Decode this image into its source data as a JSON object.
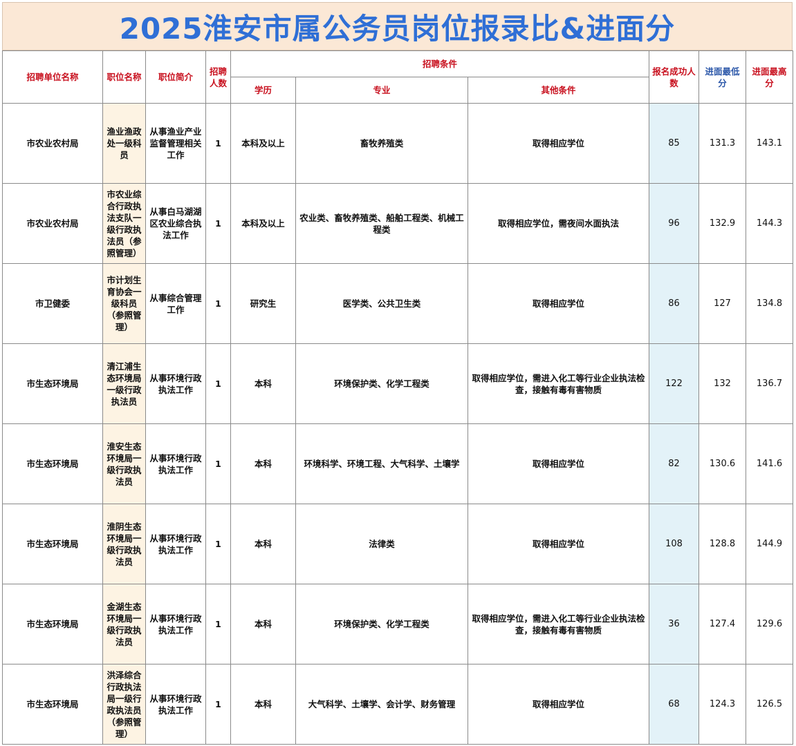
{
  "title": "2025淮安市属公务员岗位报录比&进面分",
  "headers": {
    "unit": "招聘单位名称",
    "position": "职位名称",
    "intro": "职位简介",
    "count": "招聘人数",
    "conditions": "招聘条件",
    "education": "学历",
    "major": "专业",
    "other": "其他条件",
    "applicants": "报名成功人数",
    "min_score": "进面最低分",
    "max_score": "进面最高分"
  },
  "rows": [
    {
      "unit": "市农业农村局",
      "position": "渔业渔政处一级科员",
      "intro": "从事渔业产业监督管理相关工作",
      "count": "1",
      "education": "本科及以上",
      "major": "畜牧养殖类",
      "other": "取得相应学位",
      "applicants": "85",
      "min": "131.3",
      "max": "143.1"
    },
    {
      "unit": "市农业农村局",
      "position": "市农业综合行政执法支队一级行政执法员（参照管理）",
      "intro": "从事白马湖湖区农业综合执法工作",
      "count": "1",
      "education": "本科及以上",
      "major": "农业类、畜牧养殖类、船舶工程类、机械工程类",
      "other": "取得相应学位，需夜间水面执法",
      "applicants": "96",
      "min": "132.9",
      "max": "144.3"
    },
    {
      "unit": "市卫健委",
      "position": "市计划生育协会一级科员（参照管理）",
      "intro": "从事综合管理工作",
      "count": "1",
      "education": "研究生",
      "major": "医学类、公共卫生类",
      "other": "取得相应学位",
      "applicants": "86",
      "min": "127",
      "max": "134.8"
    },
    {
      "unit": "市生态环境局",
      "position": "清江浦生态环境局一级行政执法员",
      "intro": "从事环境行政执法工作",
      "count": "1",
      "education": "本科",
      "major": "环境保护类、化学工程类",
      "other": "取得相应学位，需进入化工等行业企业执法检查，接触有毒有害物质",
      "applicants": "122",
      "min": "132",
      "max": "136.7"
    },
    {
      "unit": "市生态环境局",
      "position": "淮安生态环境局一级行政执法员",
      "intro": "从事环境行政执法工作",
      "count": "1",
      "education": "本科",
      "major": "环境科学、环境工程、大气科学、土壤学",
      "other": "取得相应学位",
      "applicants": "82",
      "min": "130.6",
      "max": "141.6"
    },
    {
      "unit": "市生态环境局",
      "position": "淮阴生态环境局一级行政执法员",
      "intro": "从事环境行政执法工作",
      "count": "1",
      "education": "本科",
      "major": "法律类",
      "other": "取得相应学位",
      "applicants": "108",
      "min": "128.8",
      "max": "144.9"
    },
    {
      "unit": "市生态环境局",
      "position": "金湖生态环境局一级行政执法员",
      "intro": "从事环境行政执法工作",
      "count": "1",
      "education": "本科",
      "major": "环境保护类、化学工程类",
      "other": "取得相应学位，需进入化工等行业企业执法检查，接触有毒有害物质",
      "applicants": "36",
      "min": "127.4",
      "max": "129.6"
    },
    {
      "unit": "市生态环境局",
      "position": "洪泽综合行政执法局一级行政执法员（参照管理）",
      "intro": "从事环境行政执法工作",
      "count": "1",
      "education": "本科",
      "major": "大气科学、土壤学、会计学、财务管理",
      "other": "取得相应学位",
      "applicants": "68",
      "min": "124.3",
      "max": "126.5"
    }
  ]
}
